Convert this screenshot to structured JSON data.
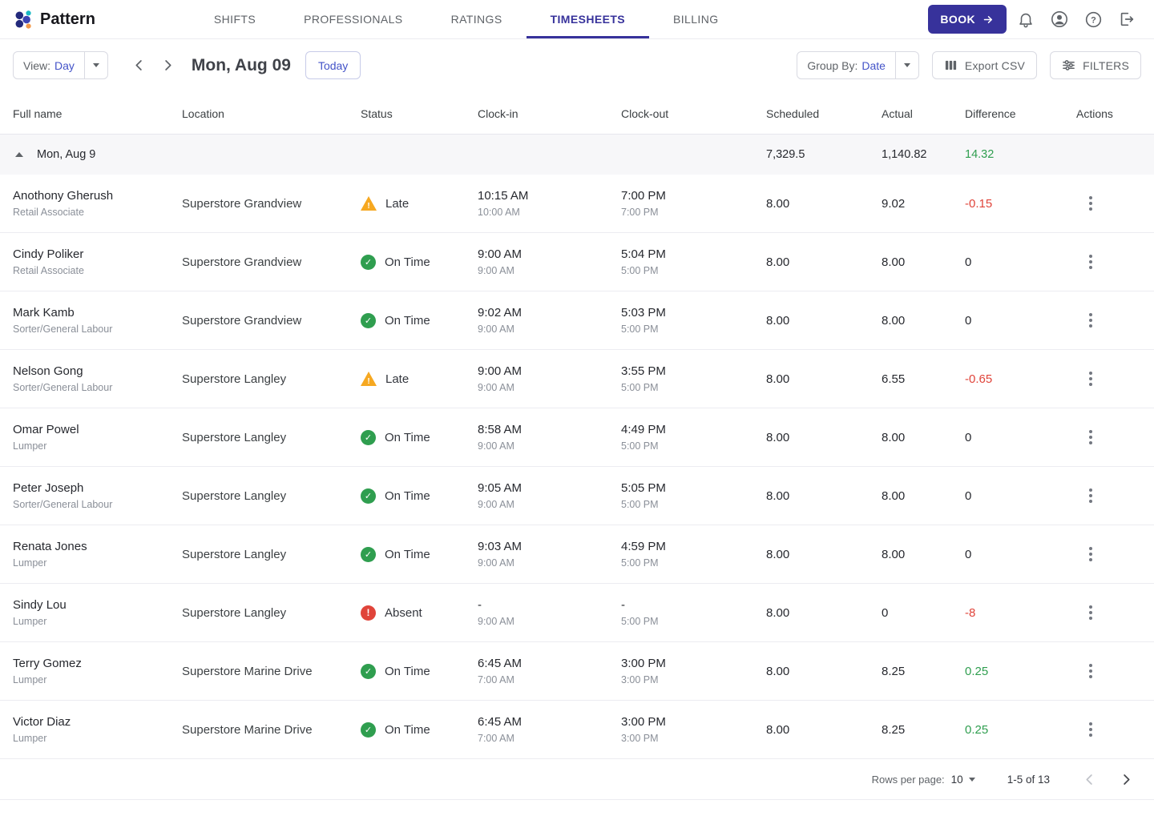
{
  "brand": {
    "name": "Pattern"
  },
  "nav": {
    "items": [
      {
        "label": "SHIFTS"
      },
      {
        "label": "PROFESSIONALS"
      },
      {
        "label": "RATINGS"
      },
      {
        "label": "TIMESHEETS"
      },
      {
        "label": "BILLING"
      }
    ],
    "book_label": "BOOK"
  },
  "toolbar": {
    "view_label": "View:",
    "view_value": "Day",
    "date_title": "Mon, Aug 09",
    "today_label": "Today",
    "group_by_label": "Group By:",
    "group_by_value": "Date",
    "export_csv_label": "Export CSV",
    "filters_label": "FILTERS"
  },
  "table": {
    "columns": [
      "Full name",
      "Location",
      "Status",
      "Clock-in",
      "Clock-out",
      "Scheduled",
      "Actual",
      "Difference",
      "Actions"
    ],
    "group_row": {
      "label": "Mon, Aug 9",
      "scheduled": "7,329.5",
      "actual": "1,140.82",
      "difference": "14.32",
      "difference_color": "green"
    },
    "rows": [
      {
        "name": "Anothony Gherush",
        "role": "Retail Associate",
        "location": "Superstore Grandview",
        "status": "Late",
        "status_type": "late",
        "clock_in": "10:15 AM",
        "clock_in_scheduled": "10:00 AM",
        "clock_out": "7:00 PM",
        "clock_out_scheduled": "7:00 PM",
        "scheduled": "8.00",
        "actual": "9.02",
        "difference": "-0.15",
        "difference_color": "red"
      },
      {
        "name": "Cindy Poliker",
        "role": "Retail Associate",
        "location": "Superstore Grandview",
        "status": "On Time",
        "status_type": "on_time",
        "clock_in": "9:00 AM",
        "clock_in_scheduled": "9:00 AM",
        "clock_out": "5:04 PM",
        "clock_out_scheduled": "5:00 PM",
        "scheduled": "8.00",
        "actual": "8.00",
        "difference": "0",
        "difference_color": "neutral"
      },
      {
        "name": "Mark Kamb",
        "role": "Sorter/General Labour",
        "location": "Superstore Grandview",
        "status": "On Time",
        "status_type": "on_time",
        "clock_in": "9:02 AM",
        "clock_in_scheduled": "9:00 AM",
        "clock_out": "5:03 PM",
        "clock_out_scheduled": "5:00 PM",
        "scheduled": "8.00",
        "actual": "8.00",
        "difference": "0",
        "difference_color": "neutral"
      },
      {
        "name": "Nelson Gong",
        "role": "Sorter/General Labour",
        "location": "Superstore Langley",
        "status": "Late",
        "status_type": "late",
        "clock_in": "9:00 AM",
        "clock_in_scheduled": "9:00 AM",
        "clock_out": "3:55 PM",
        "clock_out_scheduled": "5:00 PM",
        "scheduled": "8.00",
        "actual": "6.55",
        "difference": "-0.65",
        "difference_color": "red"
      },
      {
        "name": "Omar Powel",
        "role": "Lumper",
        "location": "Superstore Langley",
        "status": "On Time",
        "status_type": "on_time",
        "clock_in": "8:58 AM",
        "clock_in_scheduled": "9:00 AM",
        "clock_out": "4:49 PM",
        "clock_out_scheduled": "5:00 PM",
        "scheduled": "8.00",
        "actual": "8.00",
        "difference": "0",
        "difference_color": "neutral"
      },
      {
        "name": "Peter Joseph",
        "role": "Sorter/General Labour",
        "location": "Superstore Langley",
        "status": "On Time",
        "status_type": "on_time",
        "clock_in": "9:05 AM",
        "clock_in_scheduled": "9:00 AM",
        "clock_out": "5:05 PM",
        "clock_out_scheduled": "5:00 PM",
        "scheduled": "8.00",
        "actual": "8.00",
        "difference": "0",
        "difference_color": "neutral"
      },
      {
        "name": "Renata Jones",
        "role": "Lumper",
        "location": "Superstore Langley",
        "status": "On Time",
        "status_type": "on_time",
        "clock_in": "9:03 AM",
        "clock_in_scheduled": "9:00 AM",
        "clock_out": "4:59 PM",
        "clock_out_scheduled": "5:00 PM",
        "scheduled": "8.00",
        "actual": "8.00",
        "difference": "0",
        "difference_color": "neutral"
      },
      {
        "name": "Sindy Lou",
        "role": "Lumper",
        "location": "Superstore Langley",
        "status": "Absent",
        "status_type": "absent",
        "clock_in": "-",
        "clock_in_scheduled": "9:00 AM",
        "clock_out": "-",
        "clock_out_scheduled": "5:00 PM",
        "scheduled": "8.00",
        "actual": "0",
        "difference": "-8",
        "difference_color": "red"
      },
      {
        "name": "Terry Gomez",
        "role": "Lumper",
        "location": "Superstore Marine Drive",
        "status": "On Time",
        "status_type": "on_time",
        "clock_in": "6:45 AM",
        "clock_in_scheduled": "7:00 AM",
        "clock_out": "3:00 PM",
        "clock_out_scheduled": "3:00 PM",
        "scheduled": "8.00",
        "actual": "8.25",
        "difference": "0.25",
        "difference_color": "green"
      },
      {
        "name": "Victor Diaz",
        "role": "Lumper",
        "location": "Superstore Marine Drive",
        "status": "On Time",
        "status_type": "on_time",
        "clock_in": "6:45 AM",
        "clock_in_scheduled": "7:00 AM",
        "clock_out": "3:00 PM",
        "clock_out_scheduled": "3:00 PM",
        "scheduled": "8.00",
        "actual": "8.25",
        "difference": "0.25",
        "difference_color": "green"
      }
    ]
  },
  "pagination": {
    "rows_per_page_label": "Rows per page:",
    "rows_per_page_value": "10",
    "range_label": "1-5 of 13"
  },
  "colors": {
    "accent": "#4353c8",
    "accent-dark": "#37329b",
    "green": "#2f9e4f",
    "red": "#e0443a",
    "orange": "#f6a821"
  }
}
